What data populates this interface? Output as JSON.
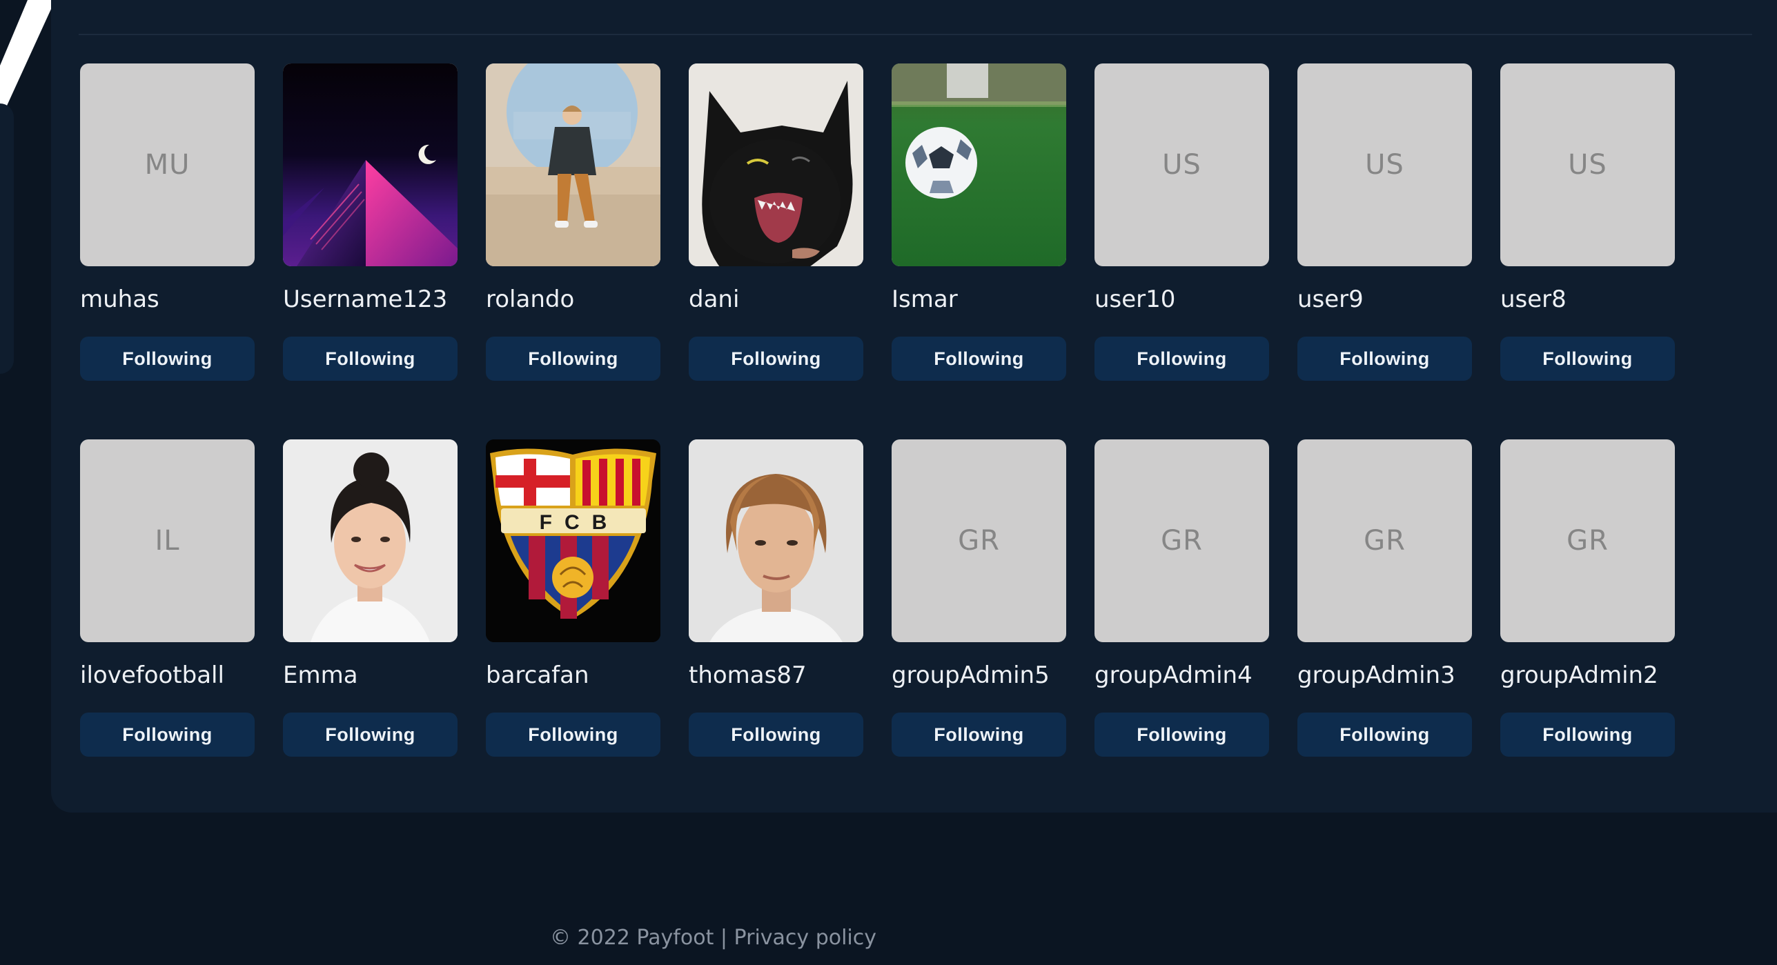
{
  "users": [
    {
      "username": "muhas",
      "initials": "MU",
      "avatar": "initials",
      "button_label": "Following"
    },
    {
      "username": "Username123",
      "initials": "",
      "avatar": "pyramid-night-image",
      "button_label": "Following"
    },
    {
      "username": "rolando",
      "initials": "",
      "avatar": "man-sitting-photo",
      "button_label": "Following"
    },
    {
      "username": "dani",
      "initials": "",
      "avatar": "black-cat-photo",
      "button_label": "Following"
    },
    {
      "username": "Ismar",
      "initials": "",
      "avatar": "soccer-ball-photo",
      "button_label": "Following"
    },
    {
      "username": "user10",
      "initials": "US",
      "avatar": "initials",
      "button_label": "Following"
    },
    {
      "username": "user9",
      "initials": "US",
      "avatar": "initials",
      "button_label": "Following"
    },
    {
      "username": "user8",
      "initials": "US",
      "avatar": "initials",
      "button_label": "Following"
    },
    {
      "username": "ilovefootball",
      "initials": "IL",
      "avatar": "initials",
      "button_label": "Following"
    },
    {
      "username": "Emma",
      "initials": "",
      "avatar": "woman-portrait-photo",
      "button_label": "Following"
    },
    {
      "username": "barcafan",
      "initials": "",
      "avatar": "fcb-crest-logo",
      "crest_text": "FCB",
      "button_label": "Following"
    },
    {
      "username": "thomas87",
      "initials": "",
      "avatar": "man-portrait-photo",
      "button_label": "Following"
    },
    {
      "username": "groupAdmin5",
      "initials": "GR",
      "avatar": "initials",
      "button_label": "Following"
    },
    {
      "username": "groupAdmin4",
      "initials": "GR",
      "avatar": "initials",
      "button_label": "Following"
    },
    {
      "username": "groupAdmin3",
      "initials": "GR",
      "avatar": "initials",
      "button_label": "Following"
    },
    {
      "username": "groupAdmin2",
      "initials": "GR",
      "avatar": "initials",
      "button_label": "Following"
    }
  ],
  "footer": {
    "copyright": "© 2022 Payfoot",
    "separator": "|",
    "privacy_link": "Privacy policy"
  },
  "colors": {
    "background": "#0b1522",
    "panel": "#0f1d2e",
    "button": "#0e2c4d",
    "placeholder": "#cecdcd",
    "accent_green": "#2fb34d"
  }
}
